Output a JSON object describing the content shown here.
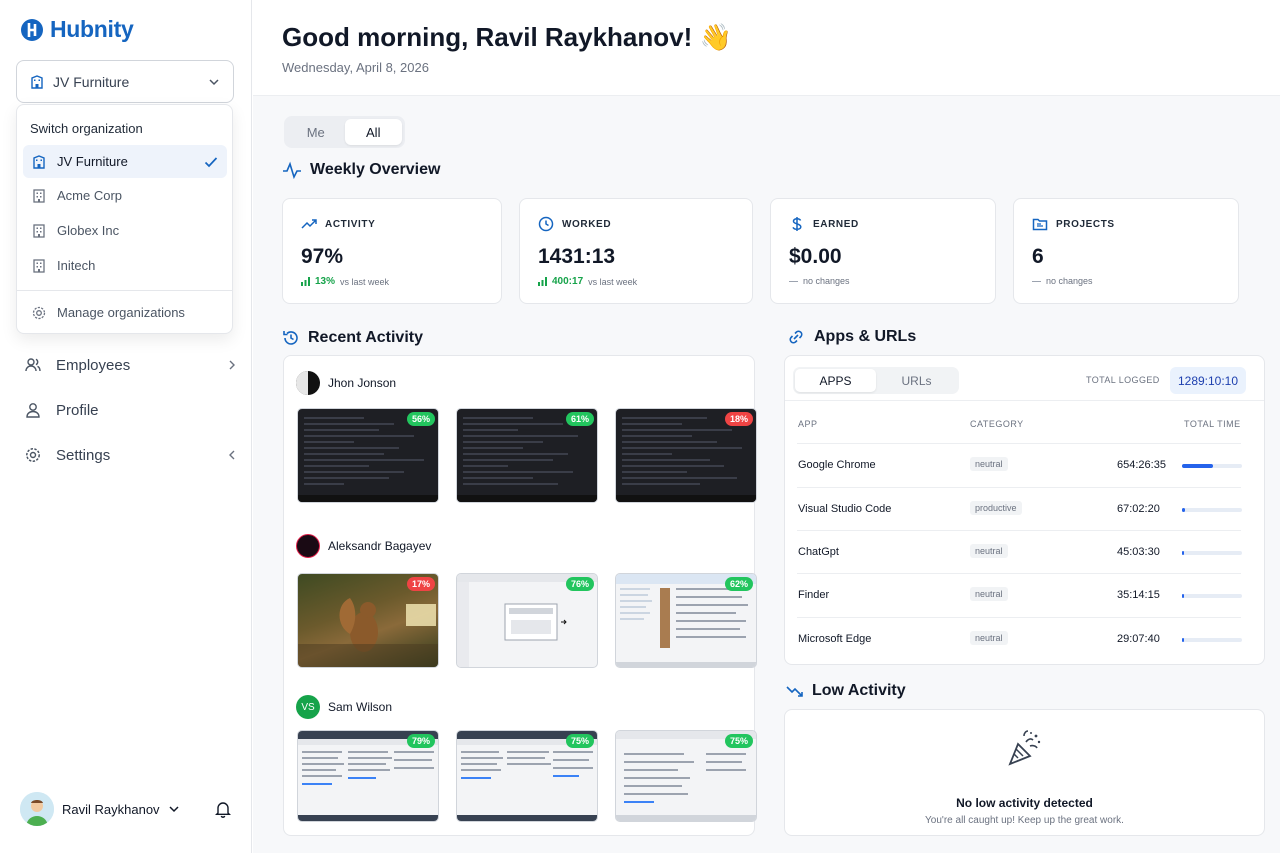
{
  "app": {
    "name": "Hubnity",
    "brand_color": "#1565c0"
  },
  "org_select": {
    "current": "JV Furniture"
  },
  "org_dropdown": {
    "title": "Switch organization",
    "items": [
      {
        "label": "JV Furniture",
        "selected": true
      },
      {
        "label": "Acme Corp",
        "selected": false
      },
      {
        "label": "Globex Inc",
        "selected": false
      },
      {
        "label": "Initech",
        "selected": false
      }
    ],
    "manage_label": "Manage organizations"
  },
  "nav": [
    {
      "label": "Employees",
      "icon": "users-icon"
    },
    {
      "label": "Profile",
      "icon": "user-icon"
    },
    {
      "label": "Settings",
      "icon": "gear-icon"
    }
  ],
  "user": {
    "name": "Ravil Raykhanov"
  },
  "header": {
    "greeting": "Good morning, Ravil Raykhanov!",
    "emoji": "👋",
    "date": "Wednesday, April 8, 2026"
  },
  "scope_toggle": {
    "options": [
      "Me",
      "All"
    ],
    "selected": "All"
  },
  "weekly": {
    "title": "Weekly Overview",
    "stats": [
      {
        "label": "ACTIVITY",
        "value": "97%",
        "delta": "13%",
        "note": "vs last week",
        "icon": "trend-up-icon"
      },
      {
        "label": "WORKED",
        "value": "1431:13",
        "delta": "400:17",
        "note": "vs last week",
        "icon": "clock-icon"
      },
      {
        "label": "EARNED",
        "value": "$0.00",
        "delta": "",
        "note": "no changes",
        "icon": "dollar-icon"
      },
      {
        "label": "PROJECTS",
        "value": "6",
        "delta": "",
        "note": "no changes",
        "icon": "folder-icon"
      }
    ]
  },
  "recent": {
    "title": "Recent Activity",
    "people": [
      {
        "name": "Jhon Jonson",
        "initials": "",
        "shots": [
          {
            "pct": "56%",
            "level": "good",
            "kind": "dark"
          },
          {
            "pct": "61%",
            "level": "good",
            "kind": "dark"
          },
          {
            "pct": "18%",
            "level": "low",
            "kind": "dark"
          }
        ]
      },
      {
        "name": "Aleksandr Bagayev",
        "initials": "",
        "shots": [
          {
            "pct": "17%",
            "level": "low",
            "kind": "photo"
          },
          {
            "pct": "76%",
            "level": "good",
            "kind": "light"
          },
          {
            "pct": "62%",
            "level": "good",
            "kind": "light"
          }
        ]
      },
      {
        "name": "Sam Wilson",
        "initials": "VS",
        "shots": [
          {
            "pct": "79%",
            "level": "good",
            "kind": "light"
          },
          {
            "pct": "75%",
            "level": "good",
            "kind": "light"
          },
          {
            "pct": "75%",
            "level": "good",
            "kind": "light"
          }
        ]
      }
    ]
  },
  "apps": {
    "title": "Apps & URLs",
    "tabs": [
      "APPS",
      "URLs"
    ],
    "selected_tab": "APPS",
    "total_label": "TOTAL LOGGED",
    "total_value": "1289:10:10",
    "columns": [
      "APP",
      "CATEGORY",
      "TOTAL TIME"
    ],
    "rows": [
      {
        "app": "Google Chrome",
        "category": "neutral",
        "time": "654:26:35",
        "share": 0.51
      },
      {
        "app": "Visual Studio Code",
        "category": "productive",
        "time": "67:02:20",
        "share": 0.05
      },
      {
        "app": "ChatGpt",
        "category": "neutral",
        "time": "45:03:30",
        "share": 0.035
      },
      {
        "app": "Finder",
        "category": "neutral",
        "time": "35:14:15",
        "share": 0.027
      },
      {
        "app": "Microsoft Edge",
        "category": "neutral",
        "time": "29:07:40",
        "share": 0.023
      }
    ]
  },
  "low_activity": {
    "title": "Low Activity",
    "empty_title": "No low activity detected",
    "empty_sub": "You're all caught up! Keep up the great work."
  }
}
